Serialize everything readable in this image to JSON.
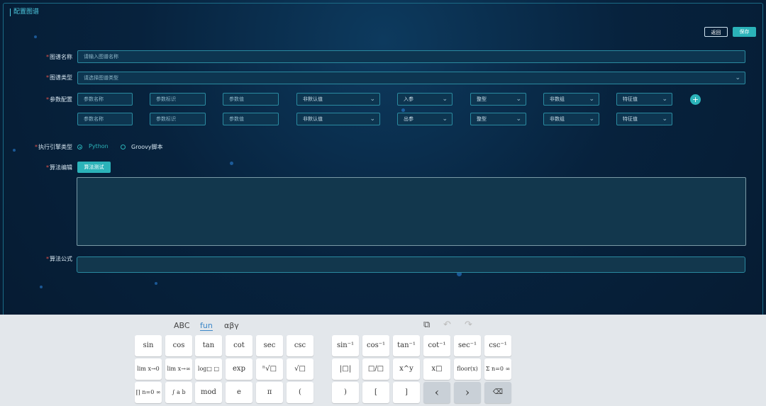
{
  "page": {
    "title": "配置图谱"
  },
  "header": {
    "back_label": "返回",
    "save_label": "保存"
  },
  "form": {
    "name": {
      "label": "图谱名称",
      "placeholder": "请输入图谱名称"
    },
    "type": {
      "label": "图谱类型",
      "placeholder": "请选择图谱类型"
    },
    "params": {
      "label": "参数配置",
      "rows": [
        {
          "name": "参数名称",
          "id": "参数标识",
          "value": "参数值",
          "default": "非默认值",
          "direction": "入参",
          "dtype": "整型",
          "array": "非数组",
          "feature": "特征值"
        },
        {
          "name": "参数名称",
          "id": "参数标识",
          "value": "参数值",
          "default": "非默认值",
          "direction": "出参",
          "dtype": "整型",
          "array": "非数组",
          "feature": "特征值"
        }
      ]
    },
    "engine": {
      "label": "执行引擎类型",
      "options": [
        "Python",
        "Groovy脚本"
      ],
      "selected": "Python"
    },
    "algo": {
      "label": "算法编辑",
      "test_label": "算法测试"
    },
    "formula": {
      "label": "算法公式"
    }
  },
  "keyboard": {
    "tabs": [
      "ABC",
      "fun",
      "αβγ"
    ],
    "active_tab": "fun",
    "icons": [
      "copy-icon",
      "undo-icon",
      "redo-icon"
    ],
    "rows": [
      [
        "sin",
        "cos",
        "tan",
        "cot",
        "sec",
        "csc",
        "sin⁻¹",
        "cos⁻¹",
        "tan⁻¹",
        "cot⁻¹",
        "sec⁻¹",
        "csc⁻¹"
      ],
      [
        "lim x→0",
        "lim x→∞",
        "log□ □",
        "exp",
        "ⁿ√□",
        "√□",
        "|□|",
        "□/□",
        "x^y",
        "x□",
        "floor(x)",
        "Σ n=0 ∞"
      ],
      [
        "∏ n=0 ∞",
        "∫ a b",
        "mod",
        "e",
        "π",
        "(",
        ")",
        "[",
        "]",
        "‹",
        "›",
        "⌫"
      ]
    ]
  }
}
